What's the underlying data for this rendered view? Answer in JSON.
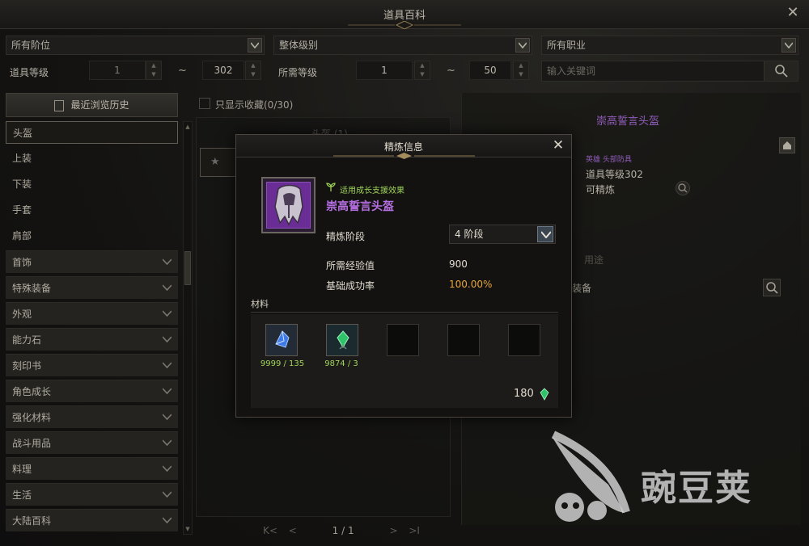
{
  "window": {
    "title": "道具百科"
  },
  "filters": {
    "tier": "所有阶位",
    "grade": "整体级别",
    "class": "所有职业",
    "item_level_label": "道具等级",
    "item_level_min": "1",
    "item_level_max": "302",
    "tilde": "~",
    "required_level_label": "所需等级",
    "required_level_min": "1",
    "required_level_max": "50",
    "search_placeholder": "输入关键词"
  },
  "sidebar": {
    "history_label": "最近浏览历史",
    "subitems": [
      {
        "label": "头盔",
        "selected": true
      },
      {
        "label": "上装"
      },
      {
        "label": "下装"
      },
      {
        "label": "手套"
      },
      {
        "label": "肩部"
      }
    ],
    "categories": [
      {
        "label": "首饰"
      },
      {
        "label": "特殊装备"
      },
      {
        "label": "外观"
      },
      {
        "label": "能力石"
      },
      {
        "label": "刻印书"
      },
      {
        "label": "角色成长"
      },
      {
        "label": "强化材料"
      },
      {
        "label": "战斗用品"
      },
      {
        "label": "料理"
      },
      {
        "label": "生活"
      },
      {
        "label": "大陆百科"
      }
    ]
  },
  "middle": {
    "fav_only_label": "只显示收藏(0/30)",
    "list_header": "头盔 (1)",
    "pager": {
      "first": "K<",
      "prev": "<",
      "page": "1 / 1",
      "next": ">",
      "last": ">I"
    }
  },
  "detail": {
    "item_name": "崇高誓言头盔",
    "category": "英雄 头部防具",
    "item_level": "道具等级302",
    "refinable": "可精炼",
    "tab_usage": "用途",
    "equip_text": "装备"
  },
  "modal": {
    "title": "精炼信息",
    "growth_badge": "适用成长支援效果",
    "item_name": "崇高誓言头盔",
    "stage_label": "精炼阶段",
    "stage_value": "4 阶段",
    "exp_label": "所需经验值",
    "exp_value": "900",
    "rate_label": "基础成功率",
    "rate_value": "100.00%",
    "materials_label": "材料",
    "materials": [
      {
        "count": "9999 / 135",
        "icon": "blue-crystal-icon"
      },
      {
        "count": "9874 / 3",
        "icon": "green-crystal-icon"
      }
    ],
    "cost_value": "180",
    "cost_icon": "green-shard-icon"
  },
  "watermark": {
    "text": "豌豆荚"
  },
  "colors": {
    "epic_purple": "#b56fe0",
    "growth_green": "#9fd45a",
    "rate_gold": "#e4a63c"
  }
}
